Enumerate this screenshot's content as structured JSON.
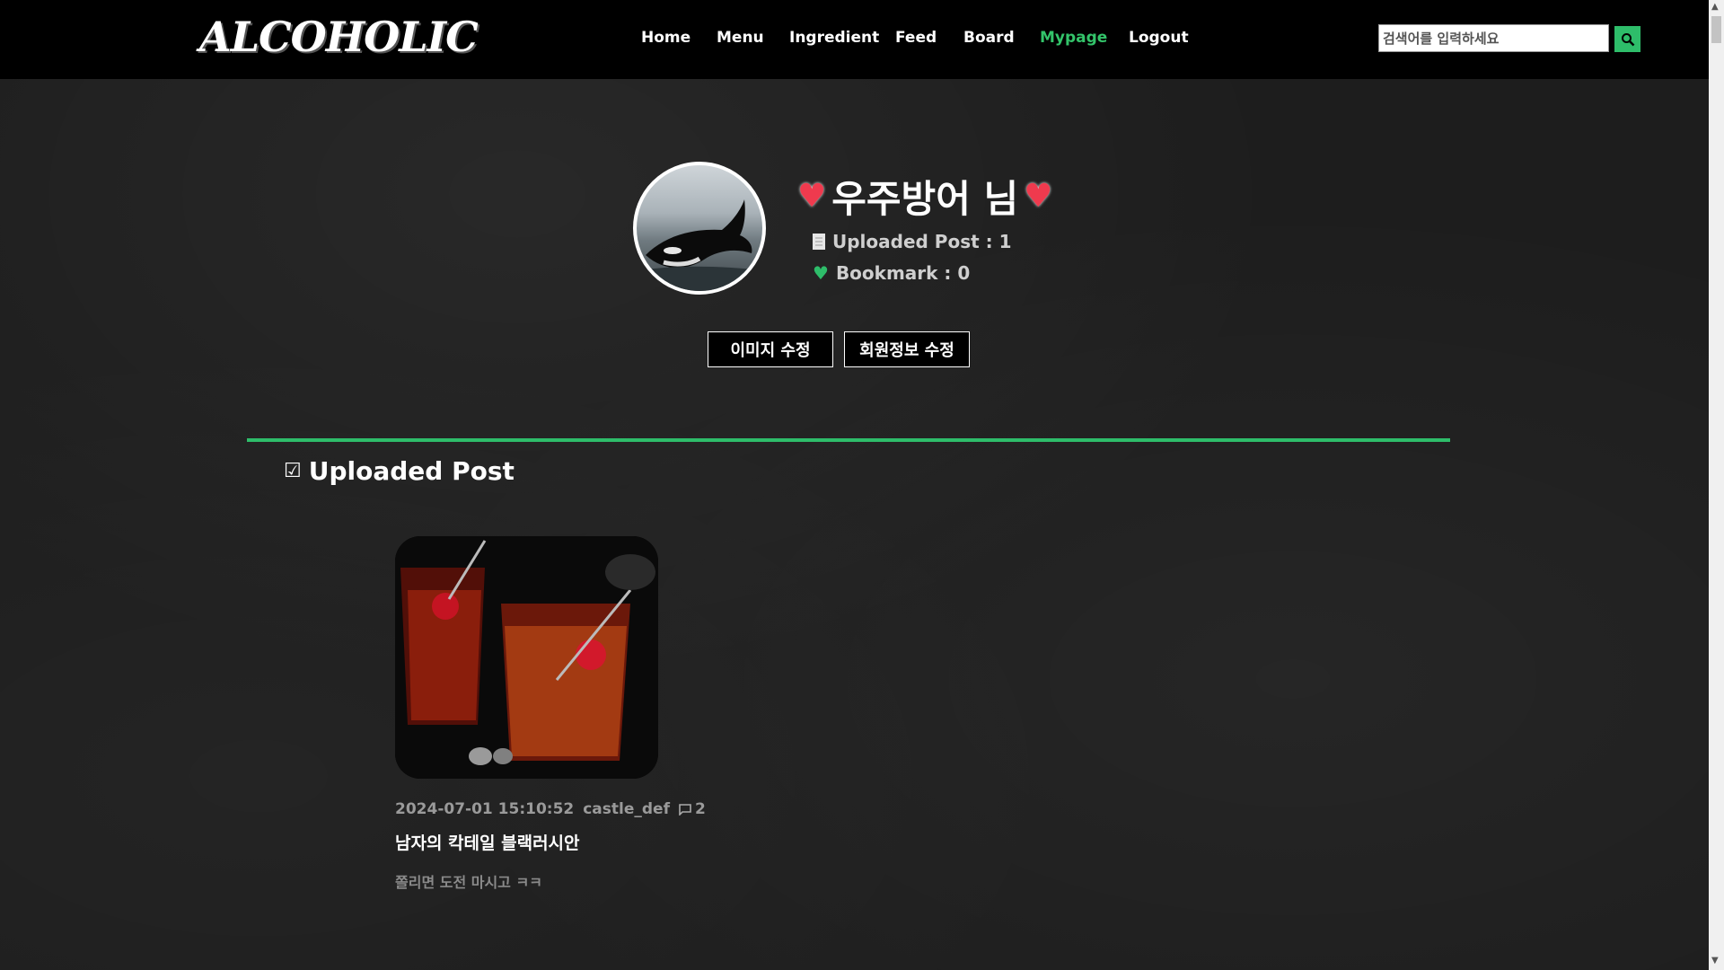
{
  "header": {
    "logo": "ALCOHOLIC",
    "nav": [
      "Home",
      "Menu",
      "Ingredient",
      "Feed",
      "Board",
      "Mypage",
      "Logout"
    ],
    "active_nav": "Mypage",
    "search": {
      "placeholder": "검색어를 입력하세요",
      "value": ""
    }
  },
  "profile": {
    "username": "우주방어 님",
    "uploaded_label": "Uploaded Post : 1",
    "bookmark_label": "Bookmark : 0",
    "edit_image_button": "이미지 수정",
    "edit_info_button": "회원정보 수정"
  },
  "section": {
    "title": "Uploaded Post"
  },
  "posts": [
    {
      "date": "2024-07-01 15:10:52",
      "author": "castle_def",
      "comments": "2",
      "title": "남자의 칵테일 블랙러시안",
      "description": "쫄리면 도전 마시고 ㅋㅋ"
    }
  ],
  "colors": {
    "accent": "#2ebd6a",
    "heart": "#ef3a4e",
    "nav_bg": "#000000"
  },
  "icons": {
    "search": "search-icon",
    "heart": "heart-icon",
    "document": "document-icon",
    "bookmark": "green-heart-icon",
    "checkbox": "checkbox-icon",
    "comment": "comment-icon"
  }
}
